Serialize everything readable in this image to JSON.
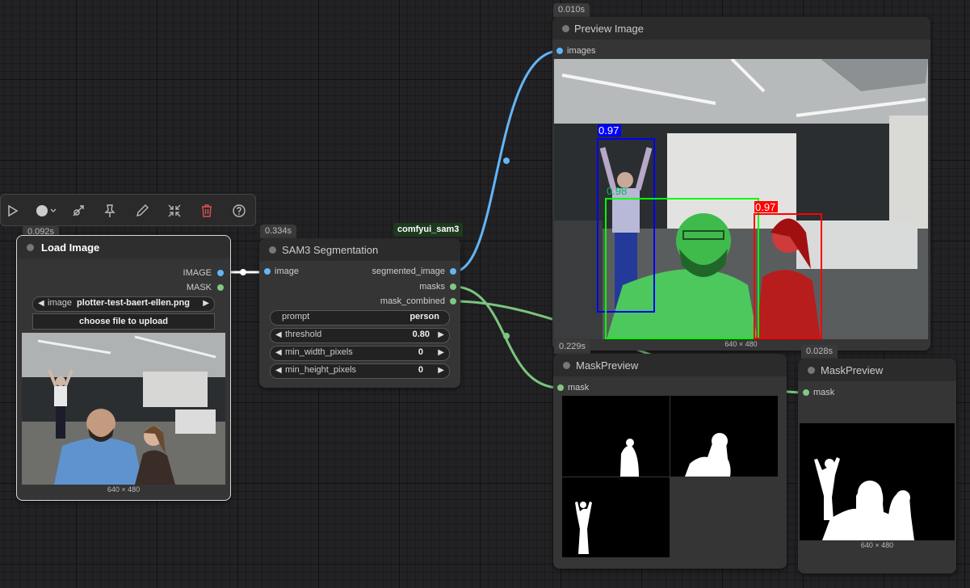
{
  "toolbar": {
    "icons": [
      "play-icon",
      "color-circle-icon",
      "bypass-icon",
      "pin-icon",
      "edit-icon",
      "collapse-icon",
      "delete-icon",
      "help-icon"
    ]
  },
  "load_image": {
    "time": "0.092s",
    "title": "Load Image",
    "outputs": [
      "IMAGE",
      "MASK"
    ],
    "image_widget_label": "image",
    "image_widget_value": "plotter-test-baert-ellen.png",
    "upload_label": "choose file to upload",
    "dims": "640 × 480"
  },
  "sam3": {
    "time": "0.334s",
    "tag": "comfyui_sam3",
    "title": "SAM3 Segmentation",
    "input": "image",
    "outputs": [
      "segmented_image",
      "masks",
      "mask_combined"
    ],
    "widgets": [
      {
        "label": "prompt",
        "value": "person"
      },
      {
        "label": "threshold",
        "value": "0.80"
      },
      {
        "label": "min_width_pixels",
        "value": "0"
      },
      {
        "label": "min_height_pixels",
        "value": "0"
      }
    ]
  },
  "preview": {
    "time": "0.010s",
    "title": "Preview Image",
    "input": "images",
    "dims": "640 × 480",
    "detections": [
      {
        "score": "0.97",
        "color": "#0000ff"
      },
      {
        "score": "0.98",
        "color": "#00ff00"
      },
      {
        "score": "0.97",
        "color": "#ff0000"
      }
    ]
  },
  "mask1": {
    "time": "0.229s",
    "title": "MaskPreview",
    "input": "mask"
  },
  "mask2": {
    "time": "0.028s",
    "title": "MaskPreview",
    "input": "mask",
    "dims": "640 × 480"
  },
  "colors": {
    "image_socket": "#64b5f6",
    "mask_socket": "#81c784",
    "image_wire": "#64b5f6",
    "mask_wire": "#7bc67e",
    "tag_bg": "#1e3a1e"
  }
}
